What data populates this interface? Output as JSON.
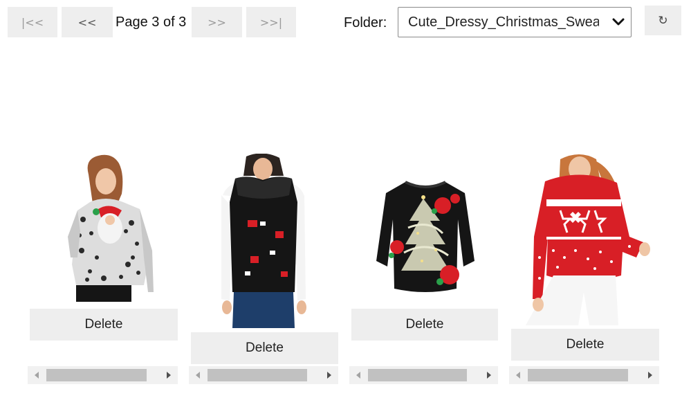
{
  "pager": {
    "first_label": "|<<",
    "prev_label": "<<",
    "page_text": "Page 3 of 3",
    "next_label": ">>",
    "last_label": ">>|"
  },
  "folder": {
    "label": "Folder:",
    "selected": "Cute_Dressy_Christmas_Sweaters"
  },
  "refresh": {
    "label": "↻"
  },
  "cards": [
    {
      "image": "santa-leopard-sweater-image",
      "delete_label": "Delete"
    },
    {
      "image": "black-fur-collar-vest-image",
      "delete_label": "Delete"
    },
    {
      "image": "black-christmas-tree-sweater-image",
      "delete_label": "Delete"
    },
    {
      "image": "red-reindeer-sweater-image",
      "delete_label": "Delete"
    }
  ],
  "colors": {
    "button_bg": "#eeeeee",
    "scroll_track": "#f1f1f1",
    "scroll_thumb": "#c1c1c1",
    "sweater_red": "#d81f26",
    "sweater_black": "#151515"
  }
}
